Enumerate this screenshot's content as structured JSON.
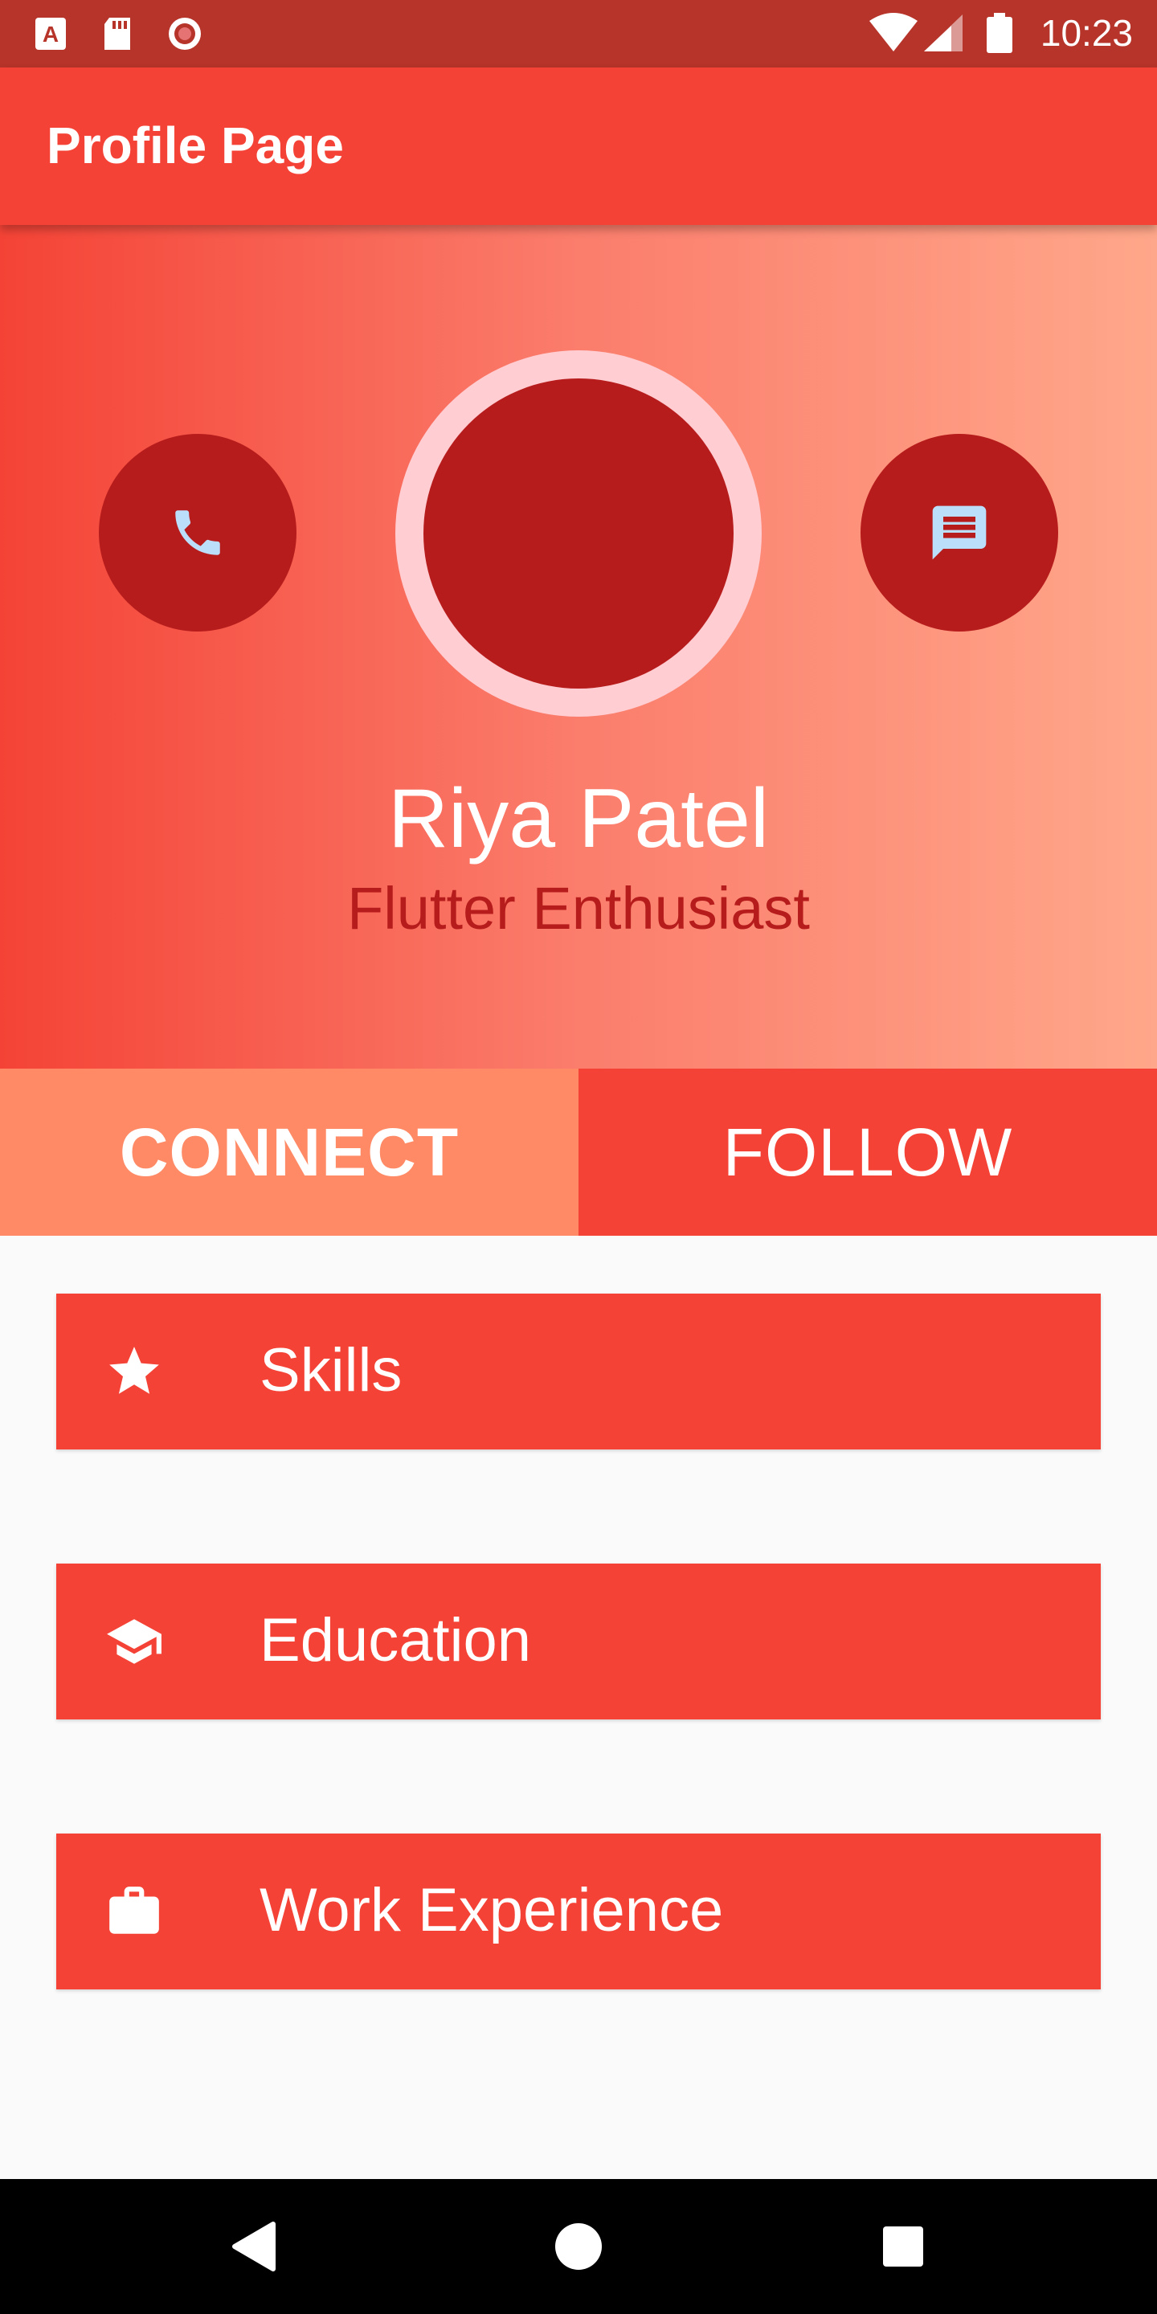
{
  "status_bar": {
    "time": "10:23",
    "icons": [
      "font-icon",
      "sd-card-icon",
      "record-icon",
      "wifi-icon",
      "signal-icon",
      "battery-icon"
    ]
  },
  "app_bar": {
    "title": "Profile Page"
  },
  "profile": {
    "name": "Riya Patel",
    "title": "Flutter Enthusiast"
  },
  "actions": {
    "connect_label": "CONNECT",
    "follow_label": "FOLLOW"
  },
  "cards": [
    {
      "label": "Skills",
      "icon": "star-icon"
    },
    {
      "label": "Education",
      "icon": "school-icon"
    },
    {
      "label": "Work Experience",
      "icon": "briefcase-icon"
    }
  ],
  "nav_bar": {
    "items": [
      "back-icon",
      "home-icon",
      "recents-icon"
    ]
  },
  "colors": {
    "primary": "#f44336",
    "primary_dark": "#b71c1c",
    "status_bar": "#b6342a",
    "connect": "#ff8a65",
    "icon_light_blue": "#bbdefb",
    "avatar_ring": "#ffcdd2"
  }
}
